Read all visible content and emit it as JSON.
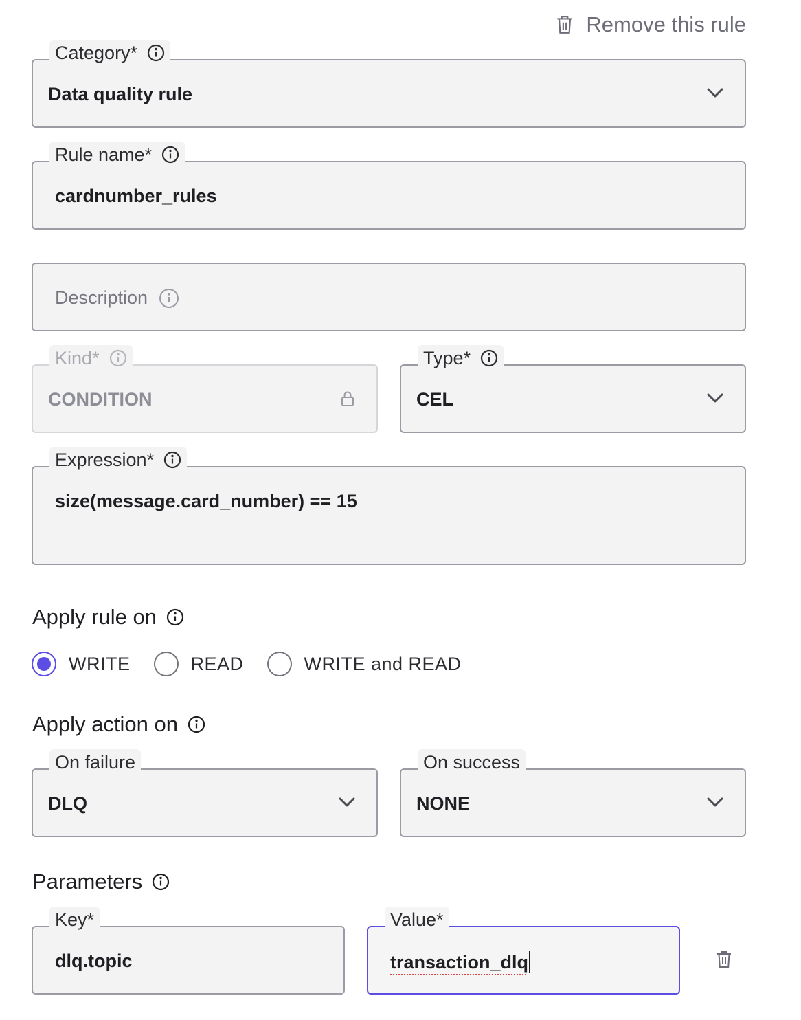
{
  "remove_rule": {
    "label": "Remove this rule",
    "icon": "trash-icon"
  },
  "category": {
    "label": "Category*",
    "value": "Data quality rule"
  },
  "rule_name": {
    "label": "Rule name*",
    "value": "cardnumber_rules"
  },
  "description": {
    "placeholder": "Description",
    "value": ""
  },
  "kind": {
    "label": "Kind*",
    "value": "CONDITION",
    "disabled": true
  },
  "type": {
    "label": "Type*",
    "value": "CEL"
  },
  "expression": {
    "label": "Expression*",
    "value": "size(message.card_number) == 15"
  },
  "apply_rule_on": {
    "heading": "Apply rule on",
    "options": [
      {
        "label": "WRITE",
        "checked": true
      },
      {
        "label": "READ",
        "checked": false
      },
      {
        "label": "WRITE and READ",
        "checked": false
      }
    ]
  },
  "apply_action_on": {
    "heading": "Apply action on",
    "on_failure": {
      "label": "On failure",
      "value": "DLQ"
    },
    "on_success": {
      "label": "On success",
      "value": "NONE"
    }
  },
  "parameters": {
    "heading": "Parameters",
    "key": {
      "label": "Key*",
      "value": "dlq.topic"
    },
    "value": {
      "label": "Value*",
      "value": "transaction_dlq"
    }
  },
  "colors": {
    "accent": "#5c4ee5",
    "border": "#9b9ba3",
    "field_bg": "#f3f3f4"
  }
}
